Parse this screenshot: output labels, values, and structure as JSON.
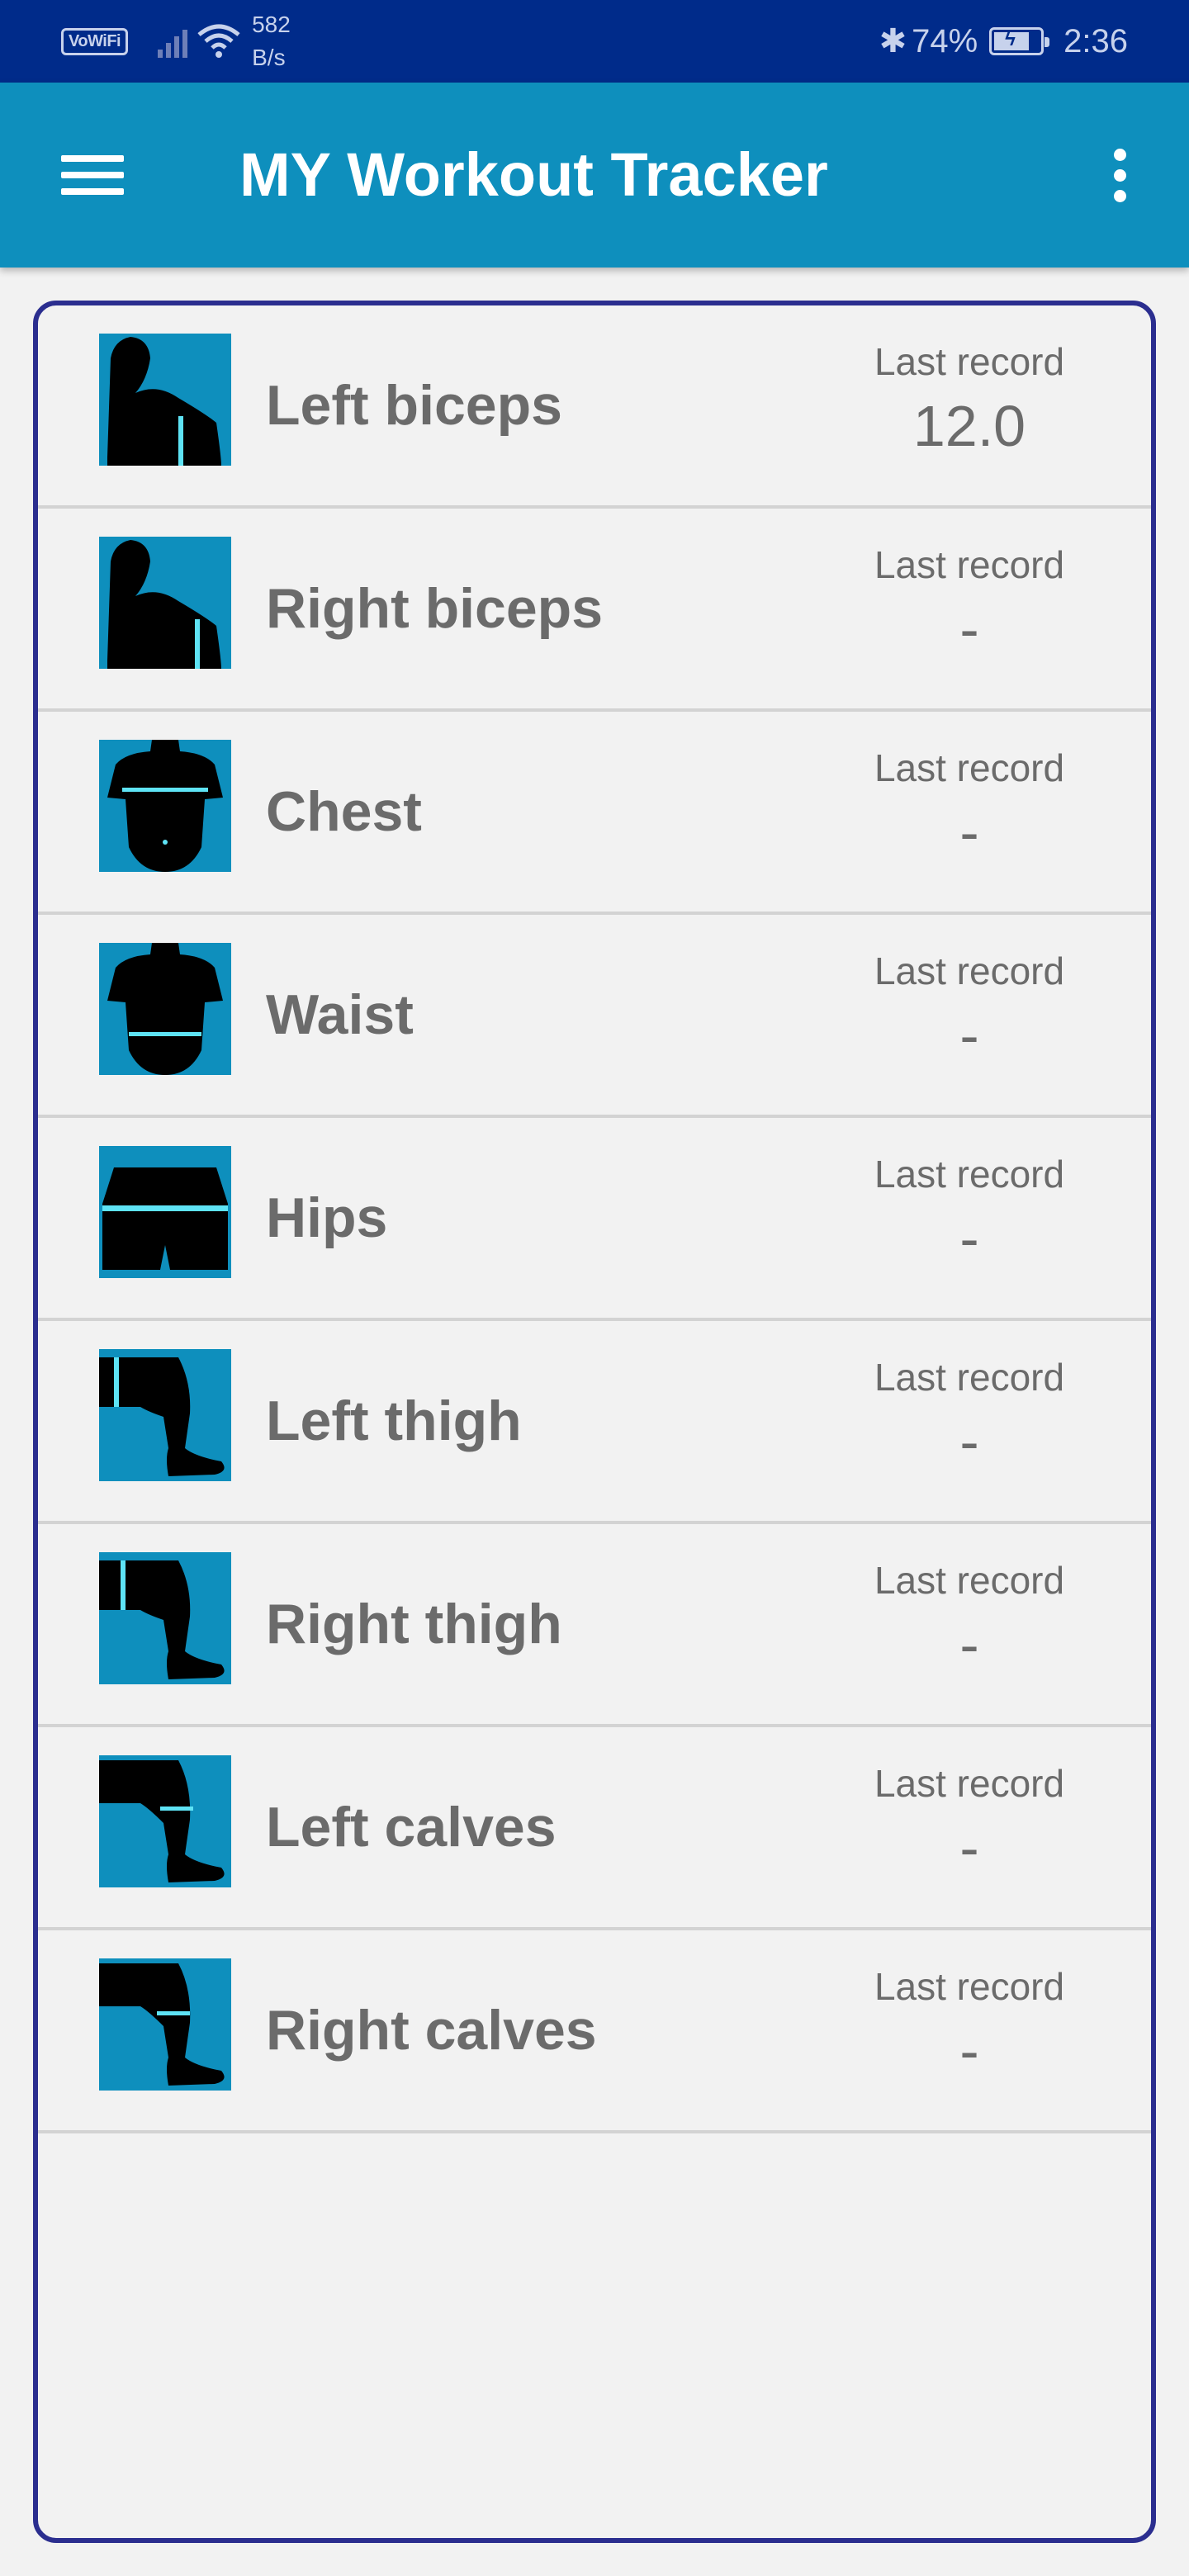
{
  "status_bar": {
    "vowifi": "VoWiFi",
    "speed_value": "582",
    "speed_unit": "B/s",
    "battery": "74%",
    "time": "2:36",
    "bluetooth_icon": "bluetooth-icon",
    "colors": {
      "background": "#002b8a",
      "text": "#c7d2ec"
    }
  },
  "app_bar": {
    "title": "MY Workout Tracker",
    "menu_icon": "hamburger-menu-icon",
    "more_icon": "more-vert-icon",
    "color": "#0e8fbd"
  },
  "list": {
    "border_color": "#2b2e8f",
    "items": [
      {
        "title": "Left biceps",
        "record_label": "Last record",
        "record_value": "12.0",
        "icon": "left-biceps-icon"
      },
      {
        "title": "Right biceps",
        "record_label": "Last record",
        "record_value": "-",
        "icon": "right-biceps-icon"
      },
      {
        "title": "Chest",
        "record_label": "Last record",
        "record_value": "-",
        "icon": "chest-icon"
      },
      {
        "title": "Waist",
        "record_label": "Last record",
        "record_value": "-",
        "icon": "waist-icon"
      },
      {
        "title": "Hips",
        "record_label": "Last record",
        "record_value": "-",
        "icon": "hips-icon"
      },
      {
        "title": "Left thigh",
        "record_label": "Last record",
        "record_value": "-",
        "icon": "left-thigh-icon"
      },
      {
        "title": "Right thigh",
        "record_label": "Last record",
        "record_value": "-",
        "icon": "right-thigh-icon"
      },
      {
        "title": "Left calves",
        "record_label": "Last record",
        "record_value": "-",
        "icon": "left-calves-icon"
      },
      {
        "title": "Right calves",
        "record_label": "Last record",
        "record_value": "-",
        "icon": "right-calves-icon"
      }
    ]
  }
}
